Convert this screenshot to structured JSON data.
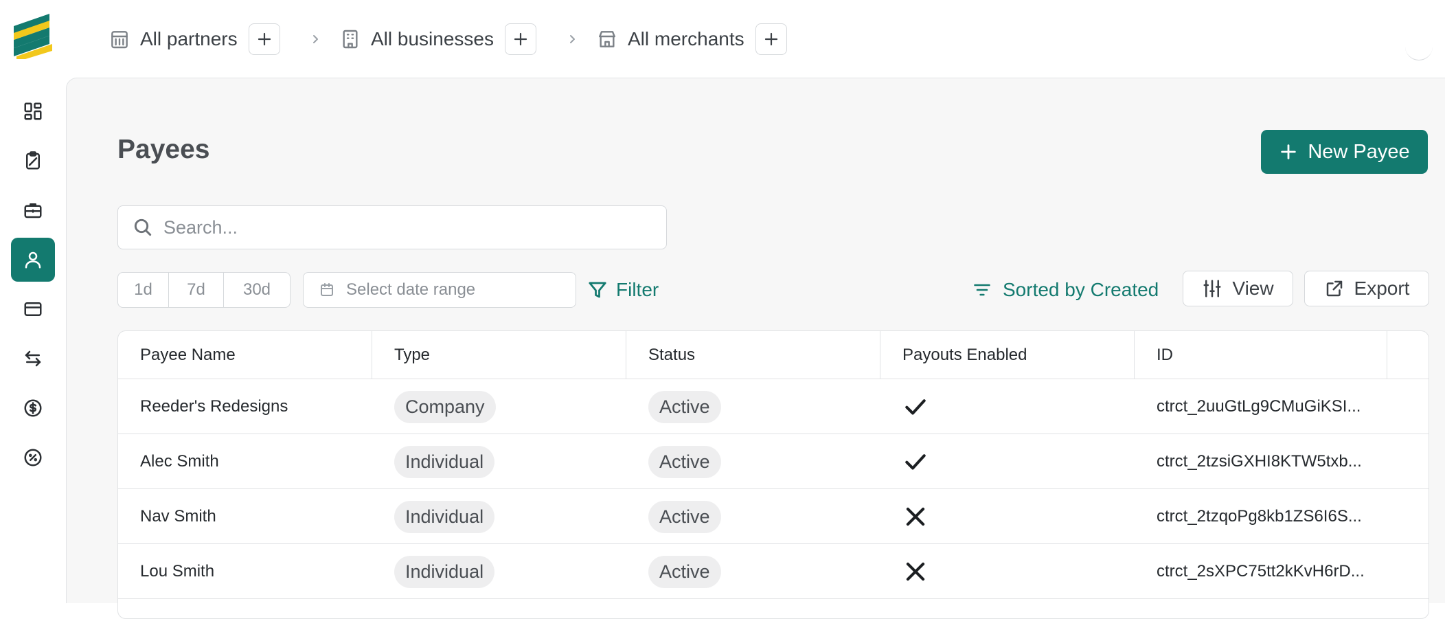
{
  "nav": {
    "items": [
      {
        "icon": "dashboard-icon",
        "active": false
      },
      {
        "icon": "clipboard-icon",
        "active": false
      },
      {
        "icon": "briefcase-icon",
        "active": false
      },
      {
        "icon": "user-icon",
        "active": true
      },
      {
        "icon": "card-icon",
        "active": false
      },
      {
        "icon": "transfer-icon",
        "active": false
      },
      {
        "icon": "dollar-icon",
        "active": false
      },
      {
        "icon": "percent-icon",
        "active": false
      }
    ]
  },
  "breadcrumb": {
    "partners": "All partners",
    "businesses": "All businesses",
    "merchants": "All merchants"
  },
  "page": {
    "title": "Payees",
    "new_button": "New Payee"
  },
  "search": {
    "placeholder": "Search..."
  },
  "ranges": [
    "1d",
    "7d",
    "30d"
  ],
  "date_range_placeholder": "Select date range",
  "filter_label": "Filter",
  "sort_label": "Sorted by Created",
  "view_label": "View",
  "export_label": "Export",
  "table": {
    "columns": [
      "Payee Name",
      "Type",
      "Status",
      "Payouts Enabled",
      "ID"
    ],
    "rows": [
      {
        "name": "Reeder's Redesigns",
        "type": "Company",
        "status": "Active",
        "payouts": true,
        "id": "ctrct_2uuGtLg9CMuGiKSI..."
      },
      {
        "name": "Alec Smith",
        "type": "Individual",
        "status": "Active",
        "payouts": true,
        "id": "ctrct_2tzsiGXHI8KTW5txb..."
      },
      {
        "name": "Nav Smith",
        "type": "Individual",
        "status": "Active",
        "payouts": false,
        "id": "ctrct_2tzqoPg8kb1ZS6I6S..."
      },
      {
        "name": "Lou Smith",
        "type": "Individual",
        "status": "Active",
        "payouts": false,
        "id": "ctrct_2sXPC75tt2kKvH6rD..."
      }
    ]
  },
  "colors": {
    "accent": "#137a6f",
    "logo_green": "#137a6f",
    "logo_yellow": "#f2c81c"
  }
}
